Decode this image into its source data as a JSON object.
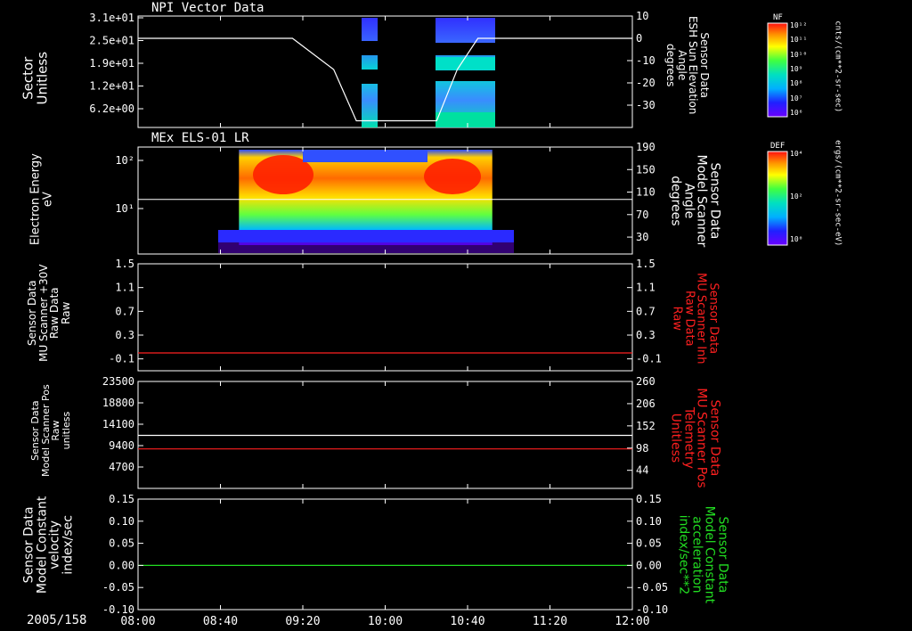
{
  "time_axis": {
    "date_label": "2005/158",
    "ticks": [
      "08:00",
      "08:40",
      "09:20",
      "10:00",
      "10:40",
      "11:20",
      "12:00"
    ],
    "tick_minutes": [
      480,
      520,
      560,
      600,
      640,
      680,
      720
    ],
    "range_minutes": [
      480,
      720
    ]
  },
  "colorbars": [
    {
      "name": "NF",
      "unit": "cnts/(cm**2-sr-sec)",
      "labels": [
        "10¹²",
        "10¹¹",
        "10¹⁰",
        "10⁹",
        "10⁸",
        "10⁷",
        "10⁶"
      ]
    },
    {
      "name": "DEF",
      "unit": "ergs/(cm**2-sr-sec-eV)",
      "labels": [
        "10⁴",
        "10²",
        "10⁰"
      ]
    }
  ],
  "chart_data": [
    {
      "type": "heatmap",
      "title": "NPI Vector Data",
      "ylabel": "Sector\nUnitless",
      "y_ticks": [
        "3.1e+01",
        "2.5e+01",
        "1.9e+01",
        "1.2e+01",
        "6.2e+00"
      ],
      "y2label": "Sensor Data\nESH Sun Elevation\nAngle\ndegrees",
      "y2_ticks": [
        "10",
        "0",
        "-10",
        "-20",
        "-30"
      ],
      "y2_values": [
        10,
        0,
        -10,
        -20,
        -30
      ],
      "y2lim": [
        -40,
        10
      ],
      "overlay_line": {
        "x": [
          480,
          555,
          575,
          586,
          625,
          635,
          645,
          720
        ],
        "y": [
          0,
          0,
          -14,
          -37,
          -37,
          -14,
          0,
          0
        ]
      },
      "blocks": [
        {
          "x0": 593,
          "x1": 597
        },
        {
          "x0": 620,
          "x1": 636
        }
      ]
    },
    {
      "type": "heatmap",
      "title": "MEx ELS-01 LR",
      "ylabel": "Electron Energy\neV",
      "y_ticks": [
        "10²",
        "10¹"
      ],
      "y2label": "Sensor Data\nModel Scanner\nAngle\ndegrees",
      "y2_ticks": [
        "190",
        "150",
        "110",
        "70",
        "30"
      ],
      "y2_values": [
        190,
        150,
        110,
        70,
        30
      ],
      "y2lim": [
        0,
        190
      ],
      "x_extent": [
        529,
        652
      ],
      "overlay_value": 97
    },
    {
      "type": "line",
      "ylabel": "Sensor Data\nMU Scanner +30V\nRaw Data\nRaw",
      "y_ticks": [
        "1.5",
        "1.1",
        "0.7",
        "0.3",
        "-0.1"
      ],
      "y_values": [
        1.5,
        1.1,
        0.7,
        0.3,
        -0.1
      ],
      "ylim": [
        -0.3,
        1.5
      ],
      "y2label": "Sensor Data\nMU Scanner Inh\nRaw Data\nRaw",
      "y2_ticks": [
        "1.5",
        "1.1",
        "0.7",
        "0.3",
        "-0.1"
      ],
      "series": [
        {
          "name": "Sensor Data MU Scanner Inh Raw Data",
          "color": "#ff2020",
          "y": [
            0,
            0
          ]
        }
      ]
    },
    {
      "type": "line",
      "ylabel": "Sensor Data\nModel Scanner Pos\nRaw\nunitless",
      "y_ticks": [
        "23500",
        "18800",
        "14100",
        "9400",
        "4700"
      ],
      "y_values": [
        23500,
        18800,
        14100,
        9400,
        4700
      ],
      "ylim": [
        0,
        23500
      ],
      "y2label": "Sensor Data\nMU Scanner Pos\nTelemetry\nUnitless",
      "y2_ticks": [
        "260",
        "206",
        "152",
        "98",
        "44"
      ],
      "y2_values": [
        260,
        206,
        152,
        98,
        44
      ],
      "y2lim": [
        0,
        260
      ],
      "series": [
        {
          "name": "Sensor Data Model Scanner Pos",
          "color": "#ffffff",
          "y": [
            11650,
            11650
          ],
          "axis": "left"
        },
        {
          "name": "Sensor Data MU Scanner Pos Telemetry",
          "color": "#ff2020",
          "y": [
            96,
            96
          ],
          "axis": "right"
        }
      ]
    },
    {
      "type": "line",
      "ylabel": "Sensor Data\nModel Constant\nvelocity\nindex/sec",
      "y_ticks": [
        "0.15",
        "0.10",
        "0.05",
        "0.00",
        "-0.05",
        "-0.10"
      ],
      "y_values": [
        0.15,
        0.1,
        0.05,
        0.0,
        -0.05,
        -0.1
      ],
      "ylim": [
        -0.1,
        0.15
      ],
      "y2label": "Sensor Data\nModel Constant\nacceleration\nindex/sec**2",
      "y2_ticks": [
        "0.15",
        "0.10",
        "0.05",
        "0.00",
        "-0.05",
        "-0.10"
      ],
      "series": [
        {
          "name": "Sensor Data Model Constant acceleration",
          "color": "#22dd22",
          "y": [
            0,
            0
          ]
        }
      ]
    }
  ],
  "colors": {
    "red": "#ff2020",
    "green": "#22dd22",
    "white": "#ffffff"
  }
}
